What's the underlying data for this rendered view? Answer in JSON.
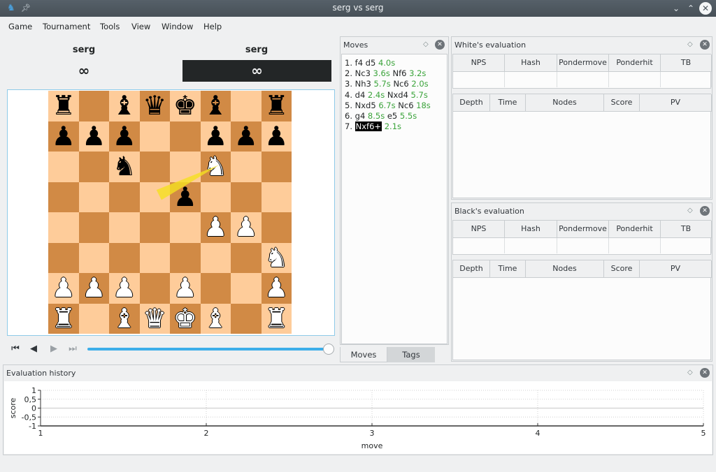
{
  "window": {
    "title": "serg vs serg",
    "icons": {
      "app": "knight-app-icon",
      "pin": "pin-icon",
      "minimize": "chevron-down-icon",
      "maximize": "chevron-up-icon",
      "close": "close-icon"
    }
  },
  "menubar": {
    "items": [
      {
        "label": "Game"
      },
      {
        "label": "Tournament"
      },
      {
        "label": "Tools"
      },
      {
        "label": "View"
      },
      {
        "label": "Window"
      },
      {
        "label": "Help"
      }
    ]
  },
  "players": {
    "white": {
      "name": "serg",
      "clock": "∞"
    },
    "black": {
      "name": "serg",
      "clock": "∞"
    }
  },
  "board": {
    "light_color": "#fecc9a",
    "dark_color": "#d18a45",
    "arrow_color": "#f5e020",
    "arrow": {
      "from": "f6",
      "to": "d5"
    },
    "ranks": [
      "r.bqkb.r",
      "ppp..ppp",
      "..n..N..",
      "....p...",
      ".....PP.",
      ".......N",
      "PPP.P..P",
      "R.BQKB.R"
    ]
  },
  "navigation": {
    "first": "first-move-icon",
    "prev": "previous-move-icon",
    "next": "next-move-icon",
    "last": "last-move-icon",
    "slider_position": 1.0
  },
  "moves_panel": {
    "title": "Moves",
    "moves": [
      {
        "num": "1.",
        "white": "f4",
        "white_time": "4.0s",
        "black": "d5",
        "black_time": "4.0s",
        "layout": "pair-single-time"
      },
      {
        "num": "2.",
        "white": "Nc3",
        "white_time": "3.6s",
        "black": "Nf6",
        "black_time": "3.2s"
      },
      {
        "num": "3.",
        "white": "Nh3",
        "white_time": "5.7s",
        "black": "Nc6",
        "black_time": "2.0s"
      },
      {
        "num": "4.",
        "white": "d4",
        "white_time": "2.4s",
        "black": "Nxd4",
        "black_time": "5.7s"
      },
      {
        "num": "5.",
        "white": "Nxd5",
        "white_time": "6.7s",
        "black": "Nc6",
        "black_time": "18s"
      },
      {
        "num": "6.",
        "white": "g4",
        "white_time": "8.5s",
        "black": "e5",
        "black_time": "5.5s"
      },
      {
        "num": "7.",
        "white": "Nxf6+",
        "white_time": "2.1s",
        "black": "",
        "black_time": "",
        "current": true
      }
    ],
    "tabs": [
      {
        "label": "Moves",
        "active": true
      },
      {
        "label": "Tags",
        "active": false
      }
    ]
  },
  "white_eval": {
    "title": "White's evaluation",
    "stats_headers": [
      "NPS",
      "Hash",
      "Pondermove",
      "Ponderhit",
      "TB"
    ],
    "pv_headers": [
      "Depth",
      "Time",
      "Nodes",
      "Score",
      "PV"
    ]
  },
  "black_eval": {
    "title": "Black's evaluation",
    "stats_headers": [
      "NPS",
      "Hash",
      "Pondermove",
      "Ponderhit",
      "TB"
    ],
    "pv_headers": [
      "Depth",
      "Time",
      "Nodes",
      "Score",
      "PV"
    ]
  },
  "eval_history": {
    "title": "Evaluation history"
  },
  "chart_data": {
    "type": "line",
    "title": "",
    "xlabel": "move",
    "ylabel": "score",
    "xlim": [
      1,
      5
    ],
    "ylim": [
      -1,
      1
    ],
    "x_ticks": [
      "1",
      "2",
      "3",
      "4",
      "5"
    ],
    "y_ticks": [
      "1",
      "0,5",
      "0",
      "-0,5",
      "-1"
    ],
    "y_tick_values": [
      1,
      0.5,
      0,
      -0.5,
      -1
    ],
    "x_tick_values": [
      1,
      2,
      3,
      4,
      5
    ],
    "grid": true,
    "series": []
  }
}
